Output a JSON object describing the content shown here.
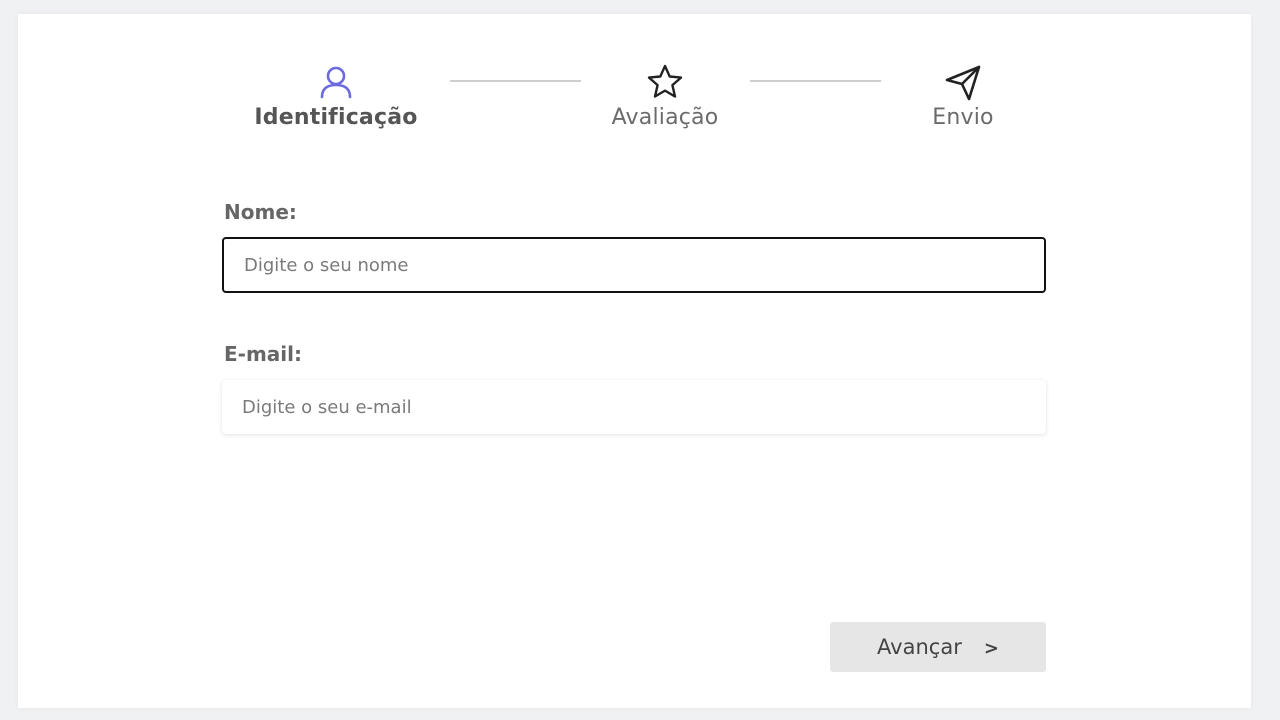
{
  "stepper": {
    "steps": [
      {
        "label": "Identificação",
        "icon": "user-icon",
        "active": true
      },
      {
        "label": "Avaliação",
        "icon": "star-icon",
        "active": false
      },
      {
        "label": "Envio",
        "icon": "send-icon",
        "active": false
      }
    ]
  },
  "form": {
    "name_label": "Nome:",
    "name_placeholder": "Digite o seu nome",
    "email_label": "E-mail:",
    "email_placeholder": "Digite o seu e-mail"
  },
  "actions": {
    "next_label": "Avançar",
    "next_chevron": ">"
  },
  "colors": {
    "accent": "#6b6be0",
    "icon_default": "#222222",
    "button_bg": "#e6e6e6"
  }
}
